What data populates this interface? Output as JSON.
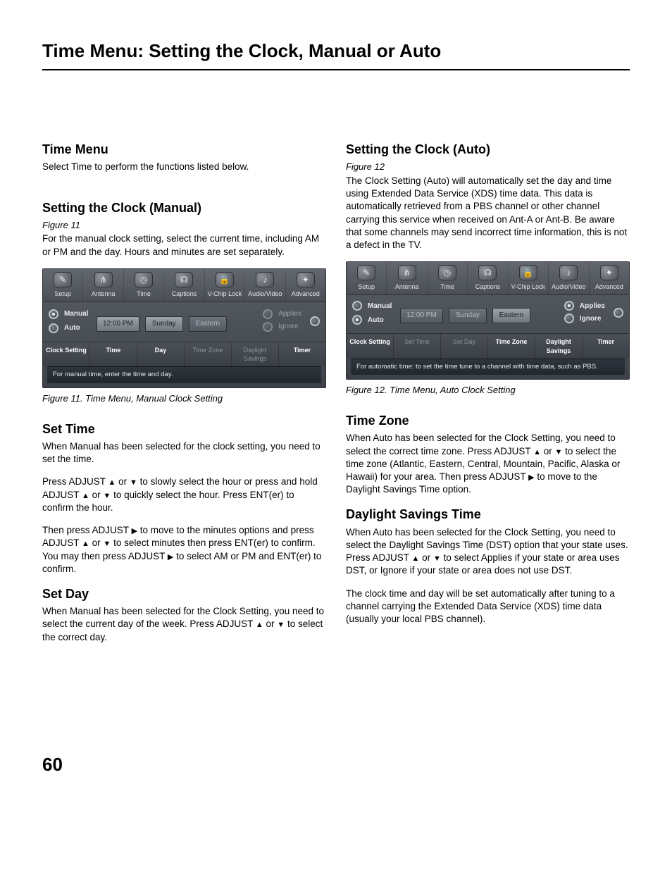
{
  "page": {
    "title": "Time Menu: Setting the Clock, Manual or Auto",
    "number": "60"
  },
  "glyphs": {
    "up": "▲",
    "down": "▼",
    "right": "▶"
  },
  "left": {
    "s1": {
      "h": "Time Menu",
      "p1": "Select Time to perform the functions listed below."
    },
    "s2": {
      "h": "Setting the Clock (Manual)",
      "fig": "Figure 11",
      "p1": "For the manual clock setting, select the current time, including AM or PM and the day.  Hours and minutes are set separately."
    },
    "fig11": {
      "cap": "Figure 11. Time Menu, Manual Clock Setting",
      "tabs": [
        "Setup",
        "Antenna",
        "Time",
        "Captions",
        "V-Chip Lock",
        "Audio/Video",
        "Advanced"
      ],
      "manual": "Manual",
      "auto": "Auto",
      "time": "12:00 PM",
      "day": "Sunday",
      "tz": "Eastern",
      "applies": "Applies",
      "ignore": "Ignore",
      "opts": [
        "Clock Setting",
        "Time",
        "Day",
        "Time Zone",
        "Daylight Savings",
        "Timer"
      ],
      "hint": "For manual time, enter the time and day."
    },
    "s3": {
      "h": "Set Time",
      "p1": "When Manual has been selected for the clock setting, you need to set the time.",
      "p2a": "Press ADJUST ",
      "p2b": " or ",
      "p2c": " to slowly select the hour or press and hold ADJUST ",
      "p2d": " or ",
      "p2e": " to quickly select the hour.  Press ENT(er) to confirm the hour.",
      "p3a": "Then press ADJUST ",
      "p3b": " to move to the minutes options and press ADJUST ",
      "p3c": " or ",
      "p3d": " to select minutes then press ENT(er) to confirm.  You may then press ADJUST ",
      "p3e": " to select AM or PM and ENT(er) to confirm."
    },
    "s4": {
      "h": "Set Day",
      "p1a": "When Manual has been selected for the Clock Setting, you need to select the current day of the week.  Press ADJUST ",
      "p1b": " or ",
      "p1c": " to select the correct day."
    }
  },
  "right": {
    "s1": {
      "h": "Setting the Clock (Auto)",
      "fig": "Figure 12",
      "p1": "The Clock Setting (Auto) will automatically set the day and time using Extended Data Service (XDS) time data.  This data is automatically retrieved from a PBS channel or other channel carrying this service when received on Ant-A or Ant-B.  Be aware that some channels may send incorrect time information, this is not a defect in the TV."
    },
    "fig12": {
      "cap": "Figure 12. Time Menu, Auto Clock Setting",
      "tabs": [
        "Setup",
        "Antenna",
        "Time",
        "Captions",
        "V-Chip Lock",
        "Audio/Video",
        "Advanced"
      ],
      "manual": "Manual",
      "auto": "Auto",
      "time": "12:00 PM",
      "day": "Sunday",
      "tz": "Eastern",
      "applies": "Applies",
      "ignore": "Ignore",
      "opts": [
        "Clock Setting",
        "Set Time",
        "Set Day",
        "Time Zone",
        "Daylight Savings",
        "Timer"
      ],
      "hint": "For automatic time: to set the time tune to a channel with time data, such as PBS."
    },
    "s2": {
      "h": "Time Zone",
      "p1a": "When Auto has been selected for the Clock Setting, you need to select the correct time zone.  Press ADJUST ",
      "p1b": " or ",
      "p1c": " to select the time zone (Atlantic, Eastern, Central, Mountain, Pacific, Alaska or Hawaii) for your area.  Then press ADJUST ",
      "p1d": " to move to the Daylight Savings Time option."
    },
    "s3": {
      "h": "Daylight Savings Time",
      "p1a": "When Auto has been selected for the Clock Setting, you need to select the Daylight Savings Time (DST) option that your state uses.  Press ADJUST ",
      "p1b": " or ",
      "p1c": " to select Applies if your state or area uses DST, or Ignore if your state or area does not use DST.",
      "p2": "The clock time and day will be set automatically after tuning to a channel carrying the Extended Data Service (XDS) time data (usually your local PBS channel)."
    }
  }
}
